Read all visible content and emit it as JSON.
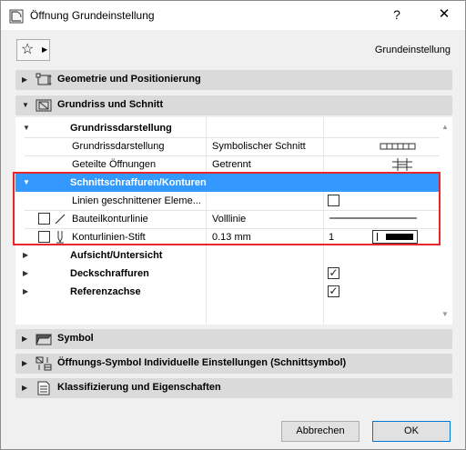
{
  "window": {
    "title": "Öffnung Grundeinstellung",
    "help": "?",
    "close": "✕"
  },
  "toolbar": {
    "favorite_icon": "star-icon",
    "preset_name": "Grundeinstellung"
  },
  "panels": [
    {
      "label": "Geometrie und Positionierung",
      "icon": "geometry-icon",
      "expanded": false
    },
    {
      "label": "Grundriss und Schnitt",
      "icon": "floorplan-icon",
      "expanded": true
    },
    {
      "label": "Symbol",
      "icon": "symbol-icon",
      "expanded": false
    },
    {
      "label": "Öffnungs-Symbol Individuelle Einstellungen (Schnittsymbol)",
      "icon": "opening-symbol-icon",
      "expanded": false
    },
    {
      "label": "Klassifizierung und Eigenschaften",
      "icon": "classification-icon",
      "expanded": false
    }
  ],
  "floorplan": {
    "group_display": {
      "label": "Grundrissdarstellung",
      "rows": [
        {
          "label": "Grundrissdarstellung",
          "value": "Symbolischer Schnitt"
        },
        {
          "label": "Geteilte Öffnungen",
          "value": "Getrennt"
        }
      ]
    },
    "group_cut": {
      "label": "Schnittschraffuren/Konturen",
      "rows": [
        {
          "label": "Linien geschnittener Eleme...",
          "checked": false
        },
        {
          "label": "Bauteilkonturlinie",
          "value": "Volllinie"
        },
        {
          "label": "Konturlinien-Stift",
          "value": "0.13 mm",
          "pen_number": "1"
        }
      ]
    },
    "group_view": {
      "label": "Aufsicht/Untersicht"
    },
    "group_fill": {
      "label": "Deckschraffuren",
      "checked": true
    },
    "group_axis": {
      "label": "Referenzachse",
      "checked": true
    }
  },
  "buttons": {
    "cancel": "Abbrechen",
    "ok": "OK"
  },
  "colors": {
    "selection": "#3399ff",
    "highlight_border": "#e8262c",
    "panel_header": "#dadada"
  }
}
